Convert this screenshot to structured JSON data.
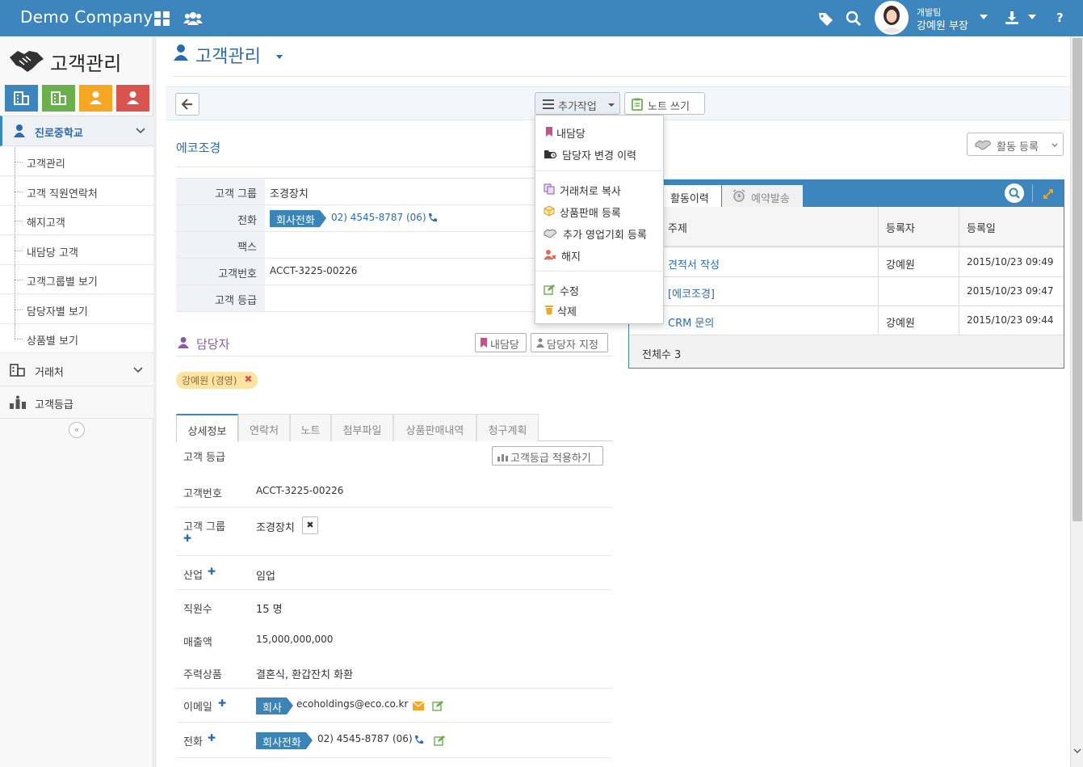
{
  "header": {
    "brand": "Demo Company",
    "user_team": "개발팀",
    "user_name": "강예원 부장",
    "help": "?"
  },
  "sidebar": {
    "title": "고객관리",
    "buttons": [
      {
        "name": "building",
        "color": "#3d86bd"
      },
      {
        "name": "building",
        "color": "#6ab04c"
      },
      {
        "name": "user",
        "color": "#f5a623"
      },
      {
        "name": "user",
        "color": "#d9534f"
      }
    ],
    "active_item": "진로중학교",
    "sub_items": [
      "고객관리",
      "고객 직원연락처",
      "해지고객",
      "내담당 고객",
      "고객그룹별 보기",
      "담당자별 보기",
      "상품별 보기"
    ],
    "items": [
      "거래처",
      "고객등급"
    ],
    "collapse": "«"
  },
  "page": {
    "title": "고객관리"
  },
  "toolbar": {
    "more_label": "추가작업",
    "note_label": "노트 쓰기"
  },
  "dropdown": {
    "items": [
      "내담당",
      "담당자 변경 이력",
      "거래처로 복사",
      "상품판매 등록",
      "추가 영업기회 등록",
      "해지",
      "수정",
      "삭제"
    ]
  },
  "customer": {
    "name": "에코조경",
    "info": {
      "group_label": "고객 그룹",
      "group_value": "조경장치",
      "phone_label": "전화",
      "phone_tag": "회사전화",
      "phone_value": "02) 4545-8787 (06)",
      "fax_label": "팩스",
      "no_label": "고객번호",
      "no_value": "ACCT-3225-00226",
      "grade_label": "고객 등급"
    }
  },
  "owners": {
    "title": "담당자",
    "my_btn": "내담당",
    "assign_btn": "담당자 지정",
    "chip": "강예원 (경영)",
    "chip_close": "✖"
  },
  "tabs": [
    "상세정보",
    "연락처",
    "노트",
    "첨부파일",
    "상품판매내역",
    "청구계획"
  ],
  "details": {
    "grade_label": "고객 등급",
    "grade_btn": "고객등급 적용하기",
    "no_label": "고객번호",
    "no_value": "ACCT-3225-00226",
    "group_label": "고객 그룹",
    "group_value": "조경장치",
    "group_remove": "✖",
    "industry_label": "산업",
    "industry_value": "임업",
    "staff_label": "직원수",
    "staff_value": "15 명",
    "sales_label": "매출액",
    "sales_value": "15,000,000,000",
    "product_label": "주력상품",
    "product_value": "결혼식, 환갑잔치 화환",
    "email_label": "이메일",
    "email_tag": "회사",
    "email_value": "ecoholdings@eco.co.kr",
    "phone_label": "전화",
    "phone_tag": "회사전화",
    "phone_value": "02) 4545-8787 (06)",
    "plus": "✚"
  },
  "activity": {
    "register_btn": "활동 등록",
    "tab_history": "활동이력",
    "tab_reserve": "예약발송",
    "columns": [
      "주제",
      "등록자",
      "등록일"
    ],
    "rows": [
      {
        "subject": "견적서 작성",
        "author": "강예원",
        "date": "2015/10/23 09:49"
      },
      {
        "subject": "[에코조경]",
        "author": "",
        "date": "2015/10/23 09:47"
      },
      {
        "subject": "CRM 문의",
        "author": "강예원",
        "date": "2015/10/23 09:44"
      }
    ],
    "total": "전체수 3"
  }
}
